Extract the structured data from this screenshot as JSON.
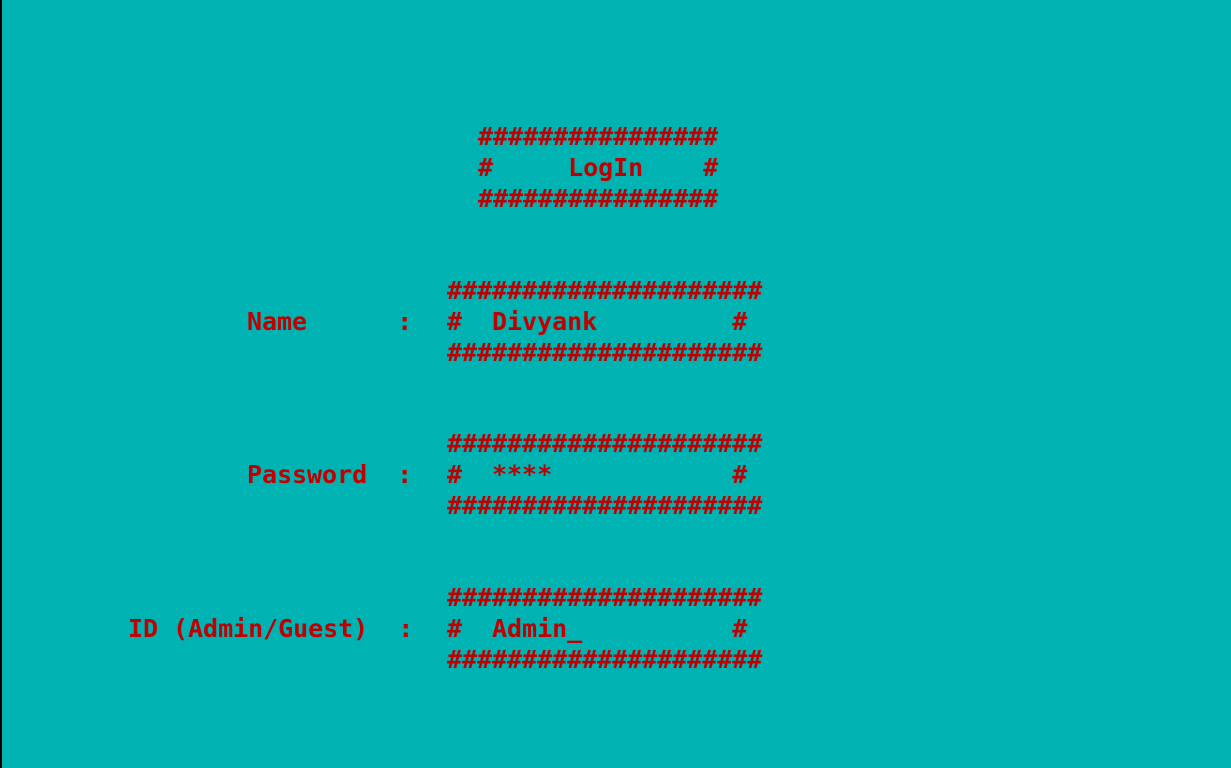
{
  "screen": {
    "background": "#00b3b3",
    "text_color": "#c00000"
  },
  "title": {
    "border_top": "################",
    "line": "#     LogIn    #",
    "border_bottom": "################"
  },
  "fields": {
    "name": {
      "label": "Name      :",
      "border": "#####################",
      "line": "#  Divyank         #"
    },
    "password": {
      "label": "Password  :",
      "border": "#####################",
      "line": "#  ****            #"
    },
    "id": {
      "label": "ID (Admin/Guest)  :",
      "border": "#####################",
      "line": "#  Admin_          #"
    }
  }
}
